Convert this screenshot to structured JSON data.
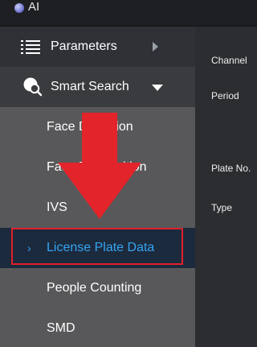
{
  "app": {
    "title": "AI"
  },
  "sidebar": {
    "parameters_label": "Parameters",
    "smart_search_label": "Smart Search",
    "items": [
      {
        "label": "Face Detection"
      },
      {
        "label": "Face Recognition"
      },
      {
        "label": "IVS"
      },
      {
        "label": "License Plate Data"
      },
      {
        "label": "People Counting"
      },
      {
        "label": "SMD"
      }
    ],
    "selected_item": "License Plate Data"
  },
  "form": {
    "channel_label": "Channel",
    "period_label": "Period",
    "plate_no_label": "Plate No.",
    "type_label": "Type"
  },
  "colors": {
    "accent": "#35a4f3",
    "highlight": "#e0202a",
    "arrow": "#e3242b"
  }
}
